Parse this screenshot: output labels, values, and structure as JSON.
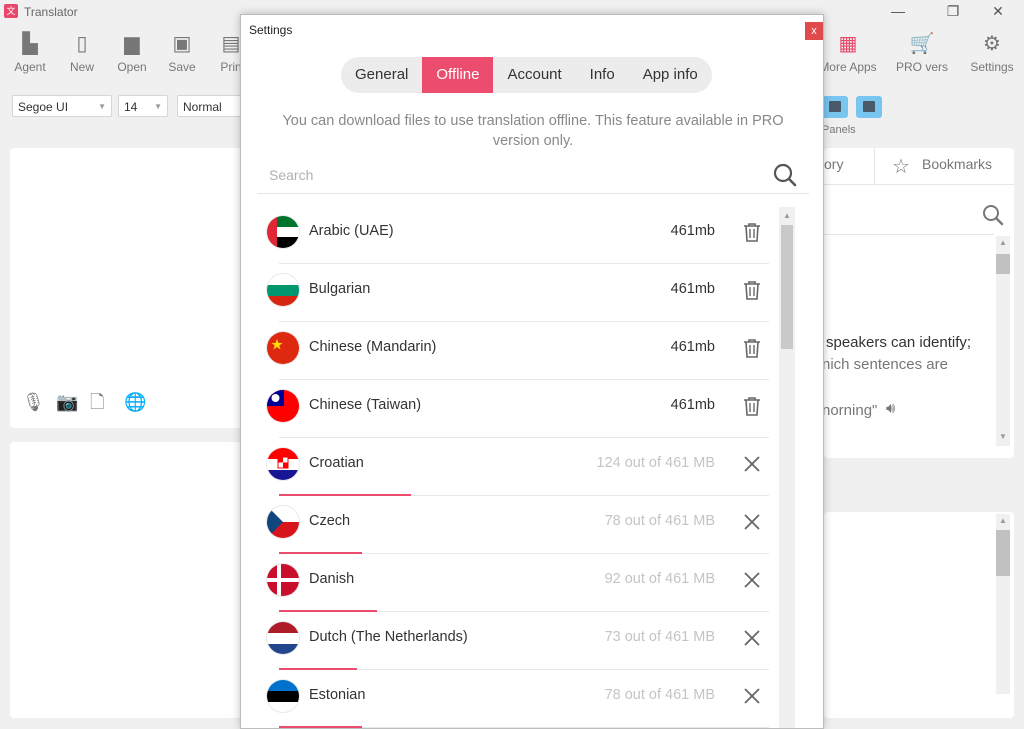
{
  "app": {
    "title": "Translator",
    "toolbar": [
      {
        "label": "Agent",
        "icon": "agent-icon"
      },
      {
        "label": "New",
        "icon": "new-file-icon"
      },
      {
        "label": "Open",
        "icon": "folder-icon"
      },
      {
        "label": "Save",
        "icon": "save-icon"
      },
      {
        "label": "Prin",
        "icon": "printer-icon"
      }
    ],
    "toolbar_right": [
      {
        "label": "More Apps",
        "icon": "apps-grid-icon"
      },
      {
        "label": "PRO vers",
        "icon": "cart-icon"
      },
      {
        "label": "Settings",
        "icon": "gear-icon"
      }
    ],
    "font_family": "Segoe UI",
    "font_size": "14",
    "font_style": "Normal",
    "panels_label": "Panels",
    "right_panel": {
      "tab_history_partial": "ory",
      "tab_bookmarks": "Bookmarks",
      "text_line1": "speakers can identify;",
      "text_line2": "nich sentences are",
      "text_line3": "norning\""
    }
  },
  "dialog": {
    "title": "Settings",
    "close": "x",
    "tabs": [
      "General",
      "Offline",
      "Account",
      "Info",
      "App info"
    ],
    "active_tab": "Offline",
    "info": "You can download files to use translation offline. This feature available in PRO version only.",
    "search_placeholder": "Search",
    "accent": "#ec4d6f",
    "languages": [
      {
        "name": "Arabic (UAE)",
        "size": "461mb",
        "state": "downloaded",
        "flag": "uae"
      },
      {
        "name": "Bulgarian",
        "size": "461mb",
        "state": "downloaded",
        "flag": "bulgaria"
      },
      {
        "name": "Chinese (Mandarin)",
        "size": "461mb",
        "state": "downloaded",
        "flag": "china"
      },
      {
        "name": "Chinese (Taiwan)",
        "size": "461mb",
        "state": "downloaded",
        "flag": "taiwan"
      },
      {
        "name": "Croatian",
        "size": "124 out of 461 MB",
        "state": "downloading",
        "progress": 0.27,
        "flag": "croatia"
      },
      {
        "name": "Czech",
        "size": "78 out of 461 MB",
        "state": "downloading",
        "progress": 0.17,
        "flag": "czech"
      },
      {
        "name": "Danish",
        "size": "92 out of 461 MB",
        "state": "downloading",
        "progress": 0.2,
        "flag": "denmark"
      },
      {
        "name": "Dutch (The Netherlands)",
        "size": "73 out of 461 MB",
        "state": "downloading",
        "progress": 0.16,
        "flag": "netherlands"
      },
      {
        "name": "Estonian",
        "size": "78 out of 461 MB",
        "state": "downloading",
        "progress": 0.17,
        "flag": "estonia"
      }
    ]
  }
}
